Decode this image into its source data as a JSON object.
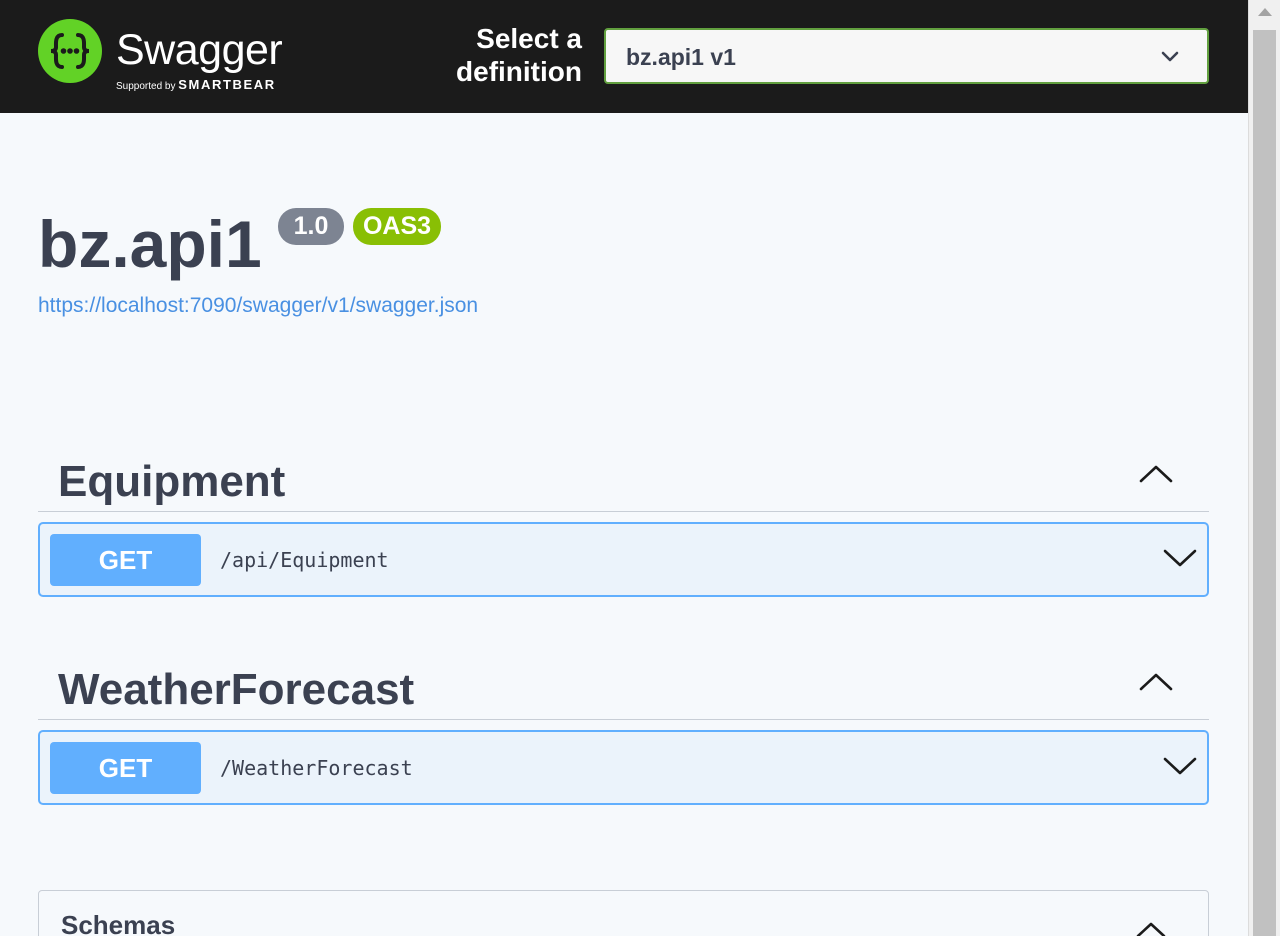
{
  "topbar": {
    "logo": {
      "icon": "swagger-braces-icon",
      "wordmark": "Swagger",
      "supported_by": "Supported by",
      "vendor": "SMARTBEAR",
      "brand_color": "#62d226"
    },
    "select_label": "Select a definition",
    "definition": {
      "selected": "bz.api1 v1",
      "icon": "chevron-down-icon"
    }
  },
  "info": {
    "title": "bz.api1",
    "version": "1.0",
    "spec_badge": "OAS3",
    "spec_url": "https://localhost:7090/swagger/v1/swagger.json"
  },
  "tags": [
    {
      "name": "Equipment",
      "toggle_icon": "chevron-up-icon",
      "operations": [
        {
          "method": "GET",
          "path": "/api/Equipment",
          "icon": "chevron-down-icon"
        }
      ]
    },
    {
      "name": "WeatherForecast",
      "toggle_icon": "chevron-up-icon",
      "operations": [
        {
          "method": "GET",
          "path": "/WeatherForecast",
          "icon": "chevron-down-icon"
        }
      ]
    }
  ],
  "schemas": {
    "title": "Schemas",
    "toggle_icon": "chevron-up-icon"
  },
  "colors": {
    "topbar_bg": "#1b1b1b",
    "page_bg": "#f6f9fc",
    "text_dark": "#3b4151",
    "get_method": "#61affe",
    "get_block_bg": "#ebf3fb",
    "version_badge": "#7d8492",
    "oas_badge": "#89bf04",
    "link": "#4990e2",
    "select_border": "#62a03f"
  }
}
